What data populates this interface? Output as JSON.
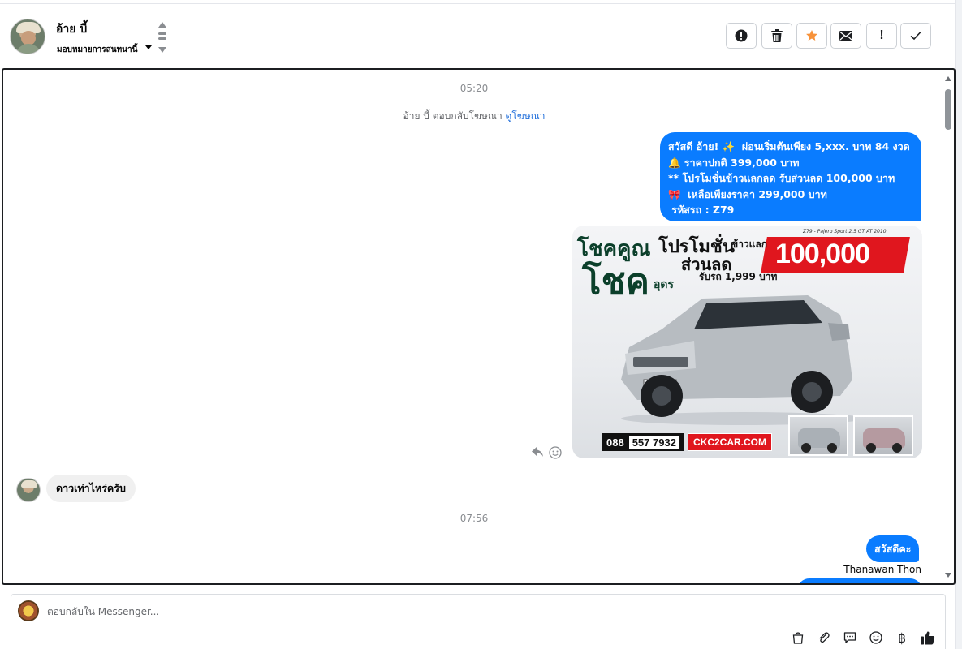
{
  "header": {
    "contact_name": "อ้าย บี้",
    "assign_label": "มอบหมายการสนทนานี้"
  },
  "toolbar": {
    "important_label": "!"
  },
  "conversation": {
    "timestamp_1": "05:20",
    "ad_reply_prefix": "อ้าย บี้ ตอบกลับโฆษณา",
    "ad_reply_link": "ดูโฆษณา",
    "promo_message": "สวัสดี อ้าย! ✨  ผ่อนเริ่มต้นเพียง 5,xxx. บาท 84 งวด\n🔔 ราคาปกติ 399,000 บาท\n** โปรโมชั่นข้าวแลกลด รับส่วนลด 100,000 บาท\n🎀  เหลือเพียงราคา 299,000 บาท\n รหัสรถ : Z79",
    "ad_image": {
      "headline_1": "โชคคูณ",
      "headline_2": "โชค",
      "headline_2b": "อุดร",
      "title": "โปรโมชั่น",
      "subtitle": "ส่วนลด",
      "trade_label": "ข้าวแลก",
      "price": "100,000",
      "model": "Z79 - Pajero Sport 2.5 GT AT 2010",
      "down_label": "รับรถ 1,999 บาท",
      "phone_part_1": "088",
      "phone_part_2": "557 7932",
      "website": "CKC2CAR.COM"
    },
    "incoming_message": "ดาวเท่าไหร่ครับ",
    "timestamp_2": "07:56",
    "outgoing_message_2": "สวัสดีคะ",
    "sender_name": "Thanawan Thon"
  },
  "composer": {
    "placeholder": "ตอบกลับใน Messenger..."
  },
  "colors": {
    "brand_blue": "#0a7cff",
    "star_orange": "#f7923a",
    "link_blue": "#216fdb"
  },
  "icons": [
    "alert-circle-icon",
    "trash-icon",
    "star-icon",
    "envelope-icon",
    "check-icon",
    "reply-icon",
    "emoji-reaction-icon",
    "shopping-bag-icon",
    "paperclip-icon",
    "saved-reply-icon",
    "emoji-icon",
    "baht-icon",
    "thumbs-up-icon"
  ]
}
